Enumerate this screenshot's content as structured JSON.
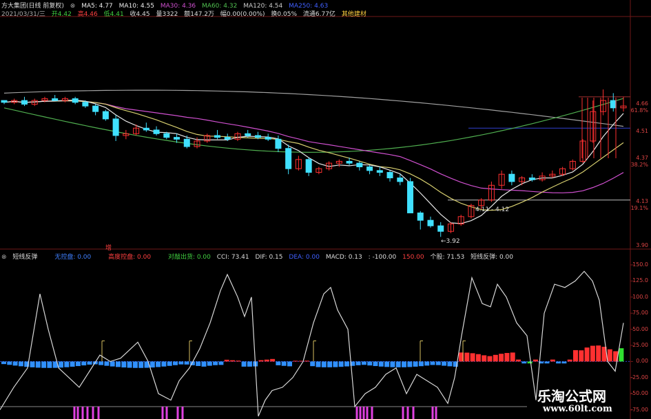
{
  "header": {
    "line1": {
      "title": "方大集团(日线 前复权)",
      "ma5": "MA5: 4.77",
      "ma10": "MA10: 4.55",
      "ma30": "MA30: 4.36",
      "ma60": "MA60: 4.32",
      "ma120": "MA120: 4.54",
      "ma250": "MA250: 4.63"
    },
    "line2": {
      "date": "2021/03/31/三",
      "open": "开4.42",
      "high": "高4.46",
      "low": "低4.41",
      "close": "收4.45",
      "volume": "量3322",
      "amount": "额147.2万",
      "amplitude": "幅0.00(0.00%)",
      "turnover": "换0.05%",
      "float": "流通6.77亿",
      "sector": "其他建材"
    }
  },
  "right_axis": {
    "p1": "4.66",
    "p1pct": "61.8%",
    "p2": "4.51",
    "p3": "4.37",
    "p3pct": "38.2%",
    "p4": "4.13",
    "p4pct": "19.1%",
    "p5": "3.90"
  },
  "annotations": {
    "low_mark": "3.92",
    "mid_mark": "4.11 - 4.12",
    "increase": "增"
  },
  "indicator": {
    "name": "短线反弹",
    "v1": "无控盘: 0.00",
    "v2": "高度控盘: 0.00",
    "v3": "对敲出货: 0.00",
    "cci": "CCI: 73.41",
    "dif": "DIF: 0.15",
    "dea": "DEA: 0.00",
    "macd": "MACD: 0.13",
    "v4": ": -100.00",
    "v5": "150.00",
    "v6": "个股: 71.53",
    "v7": "短线反弹: 0.00"
  },
  "indicator_axis": [
    "150.0",
    "125.0",
    "100.0",
    "75.00",
    "50.00",
    "25.00",
    "0.00",
    "-25.00",
    "-50.00",
    "-75.00"
  ],
  "watermark": {
    "cn": "乐淘公式网",
    "url": "www.60lt.com"
  },
  "colors": {
    "up": "#ff3030",
    "down": "#40e0ff",
    "ma_white": "#e8e8e8",
    "ma_yellow": "#d8d070",
    "ma_magenta": "#d050d0",
    "ma_green": "#50b050",
    "ma_gray": "#a0a0a0",
    "grid": "#701818"
  },
  "chart_data": {
    "type": "candlestick",
    "candles": [
      [
        4.66,
        4.66,
        4.64,
        4.65
      ],
      [
        4.65,
        4.67,
        4.64,
        4.66
      ],
      [
        4.66,
        4.68,
        4.63,
        4.64
      ],
      [
        4.64,
        4.67,
        4.63,
        4.66
      ],
      [
        4.66,
        4.68,
        4.65,
        4.67
      ],
      [
        4.67,
        4.69,
        4.66,
        4.66
      ],
      [
        4.66,
        4.68,
        4.65,
        4.67
      ],
      [
        4.67,
        4.68,
        4.64,
        4.65
      ],
      [
        4.65,
        4.66,
        4.62,
        4.63
      ],
      [
        4.63,
        4.64,
        4.58,
        4.6
      ],
      [
        4.6,
        4.61,
        4.55,
        4.56
      ],
      [
        4.56,
        4.58,
        4.44,
        4.47
      ],
      [
        4.47,
        4.5,
        4.45,
        4.48
      ],
      [
        4.48,
        4.53,
        4.47,
        4.51
      ],
      [
        4.51,
        4.54,
        4.49,
        4.5
      ],
      [
        4.5,
        4.52,
        4.47,
        4.48
      ],
      [
        4.48,
        4.49,
        4.45,
        4.46
      ],
      [
        4.46,
        4.48,
        4.43,
        4.45
      ],
      [
        4.45,
        4.47,
        4.4,
        4.41
      ],
      [
        4.41,
        4.46,
        4.4,
        4.44
      ],
      [
        4.44,
        4.48,
        4.43,
        4.47
      ],
      [
        4.47,
        4.5,
        4.45,
        4.46
      ],
      [
        4.46,
        4.48,
        4.44,
        4.45
      ],
      [
        4.45,
        4.49,
        4.44,
        4.48
      ],
      [
        4.48,
        4.5,
        4.46,
        4.47
      ],
      [
        4.47,
        4.49,
        4.45,
        4.46
      ],
      [
        4.46,
        4.48,
        4.44,
        4.45
      ],
      [
        4.45,
        4.47,
        4.38,
        4.4
      ],
      [
        4.4,
        4.42,
        4.26,
        4.29
      ],
      [
        4.29,
        4.36,
        4.28,
        4.34
      ],
      [
        4.34,
        4.35,
        4.25,
        4.27
      ],
      [
        4.27,
        4.3,
        4.26,
        4.29
      ],
      [
        4.29,
        4.33,
        4.28,
        4.32
      ],
      [
        4.32,
        4.34,
        4.3,
        4.33
      ],
      [
        4.33,
        4.35,
        4.31,
        4.32
      ],
      [
        4.32,
        4.33,
        4.28,
        4.3
      ],
      [
        4.3,
        4.31,
        4.26,
        4.28
      ],
      [
        4.28,
        4.3,
        4.25,
        4.27
      ],
      [
        4.27,
        4.28,
        4.22,
        4.24
      ],
      [
        4.24,
        4.26,
        4.2,
        4.22
      ],
      [
        4.22,
        4.24,
        4.05,
        4.05
      ],
      [
        4.05,
        4.06,
        3.96,
        4.01
      ],
      [
        4.01,
        4.03,
        3.97,
        3.98
      ],
      [
        3.98,
        4.0,
        3.92,
        3.95
      ],
      [
        3.95,
        4.0,
        3.94,
        3.99
      ],
      [
        3.99,
        4.04,
        3.98,
        4.03
      ],
      [
        4.03,
        4.1,
        4.02,
        4.09
      ],
      [
        4.09,
        4.13,
        4.07,
        4.12
      ],
      [
        4.12,
        4.22,
        4.11,
        4.2
      ],
      [
        4.2,
        4.28,
        4.18,
        4.26
      ],
      [
        4.26,
        4.28,
        4.2,
        4.22
      ],
      [
        4.22,
        4.25,
        4.2,
        4.24
      ],
      [
        4.24,
        4.26,
        4.22,
        4.23
      ],
      [
        4.23,
        4.27,
        4.22,
        4.25
      ],
      [
        4.25,
        4.28,
        4.24,
        4.26
      ],
      [
        4.26,
        4.3,
        4.25,
        4.29
      ],
      [
        4.29,
        4.34,
        4.28,
        4.33
      ],
      [
        4.33,
        4.45,
        4.32,
        4.44
      ],
      [
        4.44,
        4.66,
        4.43,
        4.6
      ],
      [
        4.6,
        4.72,
        4.58,
        4.66
      ],
      [
        4.66,
        4.7,
        4.6,
        4.62
      ],
      [
        4.62,
        4.68,
        4.6,
        4.63
      ]
    ],
    "y_range": [
      3.88,
      4.72
    ]
  }
}
